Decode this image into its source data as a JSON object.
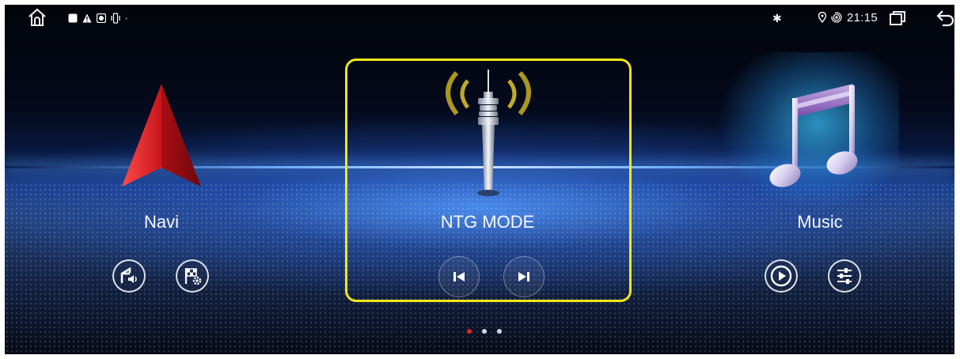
{
  "status_bar": {
    "time": "21:15",
    "left_icons": [
      "home-icon",
      "square-notification-icon",
      "warning-icon",
      "camera-icon",
      "vibrate-icon",
      "dot-icon"
    ],
    "right_icons": [
      "bluetooth-icon",
      "location-icon",
      "hotspot-icon",
      "recents-icon",
      "back-icon"
    ]
  },
  "cards": {
    "navi": {
      "label": "Navi",
      "buttons": [
        "voice-navigation-icon",
        "route-settings-icon"
      ]
    },
    "ntg": {
      "label": "NTG MODE",
      "buttons": [
        "previous-icon",
        "next-icon"
      ],
      "frame_color": "#f0e61a"
    },
    "music": {
      "label": "Music",
      "buttons": [
        "play-icon",
        "equalizer-icon"
      ]
    }
  },
  "pager": {
    "count": 3,
    "active": 1,
    "active_color": "#e3242b"
  }
}
